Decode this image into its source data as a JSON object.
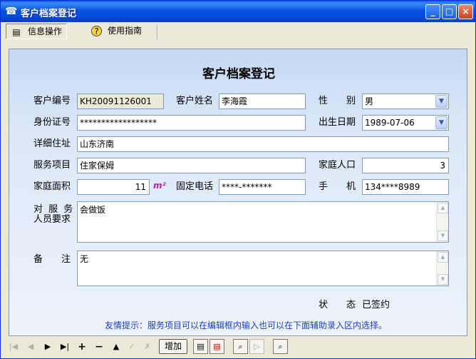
{
  "window": {
    "title": "客户档案登记",
    "minimize": "_",
    "maximize": "□",
    "close": "×"
  },
  "menu": {
    "info_ops": "信息操作",
    "guide": "使用指南"
  },
  "form": {
    "heading": "客户档案登记",
    "customer_no_label": "客户编号",
    "customer_no": "KH20091126001",
    "customer_name_label": "客户姓名",
    "customer_name": "李海霞",
    "gender_label": "性　　别",
    "gender": "男",
    "id_label": "身份证号",
    "id_value": "******************",
    "birth_label": "出生日期",
    "birth": "1989-07-06",
    "address_label": "详细住址",
    "address": "山东济南",
    "service_label": "服务项目",
    "service": "住家保姆",
    "family_label": "家庭人口",
    "family": "3",
    "area_label": "家庭面积",
    "area": "11",
    "area_unit": "m²",
    "phone_label": "固定电话",
    "phone": "****-*******",
    "mobile_label": "手　　机",
    "mobile": "134****8989",
    "req_label_1": "对 服 务",
    "req_label_2": "人员要求",
    "requirement": "会做饭",
    "remark_label": "备　　注",
    "remark": "无",
    "status_label": "状　　态",
    "status": "已签约",
    "hint": "友情提示：服务项目可以在编辑框内输入也可以在下面辅助录入区内选择。"
  },
  "navigator": {
    "first": "|◀",
    "prev": "◀",
    "next": "▶",
    "last": "▶|",
    "insert": "+",
    "delete": "−",
    "up": "▲",
    "post": "✓",
    "cancel": "✗",
    "add": "增加"
  },
  "icons": {
    "app": "app-icon",
    "info": "list-icon",
    "guide": "question-icon",
    "print": "printer-icon",
    "print2": "printer-red-icon",
    "preview": "magnifier-icon",
    "forward": "forward-icon",
    "search": "magnifier-icon"
  }
}
